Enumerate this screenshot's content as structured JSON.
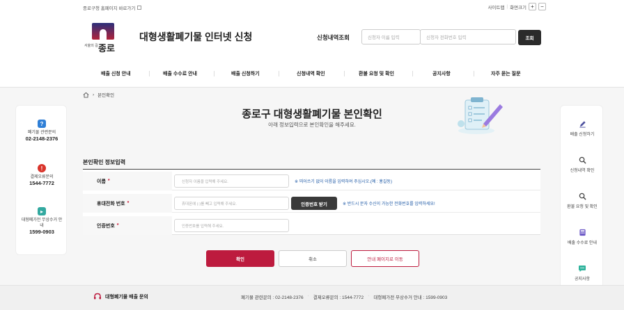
{
  "util": {
    "home_link": "종로구청 홈페이지 바로가기",
    "sitemap": "사이트맵",
    "zoom_label": "화면크기",
    "zoom_in": "+",
    "zoom_out": "−"
  },
  "header": {
    "logo_sub": "서울의 길",
    "logo_main": "종로",
    "site_title": "대형생활폐기물 인터넷 신청",
    "search_label": "신청내역조회",
    "name_placeholder": "신청자 이름 입력",
    "phone_placeholder": "신청자 전화번호 입력",
    "search_button": "조회"
  },
  "nav": [
    "배출 신청 안내",
    "배출 수수료 안내",
    "배출 신청하기",
    "신청내역 확인",
    "환불 요청 및 확인",
    "공지사항",
    "자주 묻는 질문"
  ],
  "breadcrumb": {
    "current": "본인확인"
  },
  "page": {
    "title": "종로구 대형생활폐기물 본인확인",
    "subtitle": "아래 정보입력으로 본인확인을 해주세요."
  },
  "left_panel": [
    {
      "icon": "question-icon",
      "label": "폐기물 관련문의",
      "number": "02-2148-2376",
      "color": "#2f7fd6"
    },
    {
      "icon": "alert-icon",
      "label": "결제오류문의",
      "number": "1544-7772",
      "color": "#d9342b"
    },
    {
      "icon": "truck-icon",
      "label": "대형폐가전 무상수거 안내",
      "number": "1599-0903",
      "color": "#33a9a0"
    }
  ],
  "right_panel": [
    {
      "icon": "pencil-icon",
      "label": "배출 신청하기"
    },
    {
      "icon": "search-icon",
      "label": "신청내역 확인"
    },
    {
      "icon": "refund-search-icon",
      "label": "환불 요청 및 확인"
    },
    {
      "icon": "calculator-icon",
      "label": "배출 수수료 안내"
    },
    {
      "icon": "chat-icon",
      "label": "공지사항"
    }
  ],
  "form": {
    "title": "본인확인 정보입력",
    "required_mark": "*",
    "name": {
      "label": "이름",
      "placeholder": "신청자 이름을 입력해 주세요.",
      "hint": "※ 띄어쓰기 없이 이름을 입력하여 주십시오.(예 : 홍길동)"
    },
    "phone": {
      "label": "휴대전화 번호",
      "placeholder": "휴대폰에 (-)를 빼고 입력해 주세요.",
      "verify_button": "인증번호 받기",
      "hint": "※ 반드시 문자 수신이 가능한 전화번호를 입력하세요!"
    },
    "code": {
      "label": "인증번호",
      "placeholder": "인증번호를 입력해 주세요."
    }
  },
  "buttons": {
    "confirm": "확인",
    "cancel": "취소",
    "guide": "안내 페이지로 이동"
  },
  "footer": {
    "title": "대형폐기물 배출 문의",
    "info1": "폐기물 관련문의 : 02-2148-2376",
    "info2": "결제오류문의 : 1544-7772",
    "info3": "대형폐가전 무상수거 안내 : 1599-0903",
    "separator": "·"
  },
  "colors": {
    "brand": "#bd1b3e",
    "hint": "#1f5aa6",
    "dark": "#2b2b2b"
  }
}
